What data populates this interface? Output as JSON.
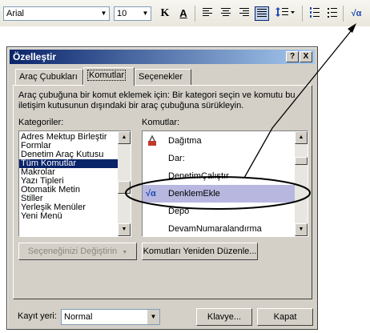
{
  "toolbar": {
    "font_name": "Arial",
    "font_size": "10",
    "bold": "K",
    "font_color": "A",
    "equation_icon": "√α"
  },
  "dialog": {
    "title": "Özelleştir",
    "help_button": "?",
    "close_button": "X",
    "tabs": [
      {
        "label": "Araç Çubukları"
      },
      {
        "label": "Komutlar"
      },
      {
        "label": "Seçenekler"
      }
    ],
    "instructions": "Araç çubuğuna bir komut eklemek için: Bir kategori seçin ve komutu bu iletişim kutusunun dışındaki bir araç çubuğuna sürükleyin.",
    "categories_label": "Kategoriler:",
    "commands_label": "Komutlar:",
    "categories": [
      "Adres Mektup Birleştir",
      "Formlar",
      "Denetim Araç Kutusu",
      "Tüm Komutlar",
      "Makrolar",
      "Yazı Tipleri",
      "Otomatik Metin",
      "Stiller",
      "Yerleşik Menüler",
      "Yeni Menü"
    ],
    "selected_category": "Tüm Komutlar",
    "commands": [
      {
        "label": "Dağıtma"
      },
      {
        "label": "Dar:"
      },
      {
        "label": "DenetimÇalıştır"
      },
      {
        "label": "DenklemEkle",
        "icon": "√α"
      },
      {
        "label": "Depo"
      },
      {
        "label": "DevamNumaralandırma"
      }
    ],
    "modify_selection_button": "Seçeneğinizi Değiştirin",
    "rearrange_button": "Komutları Yeniden Düzenle...",
    "save_in_label": "Kayıt yeri:",
    "save_in_value": "Normal",
    "keyboard_button": "Klavye...",
    "close_dialog_button": "Kapat"
  },
  "colors": {
    "title_start": "#0a246a",
    "title_end": "#a6caf0",
    "selection": "#0a246a",
    "highlight_row": "#b7b7e0",
    "dialog_face": "#d4d0c8"
  }
}
